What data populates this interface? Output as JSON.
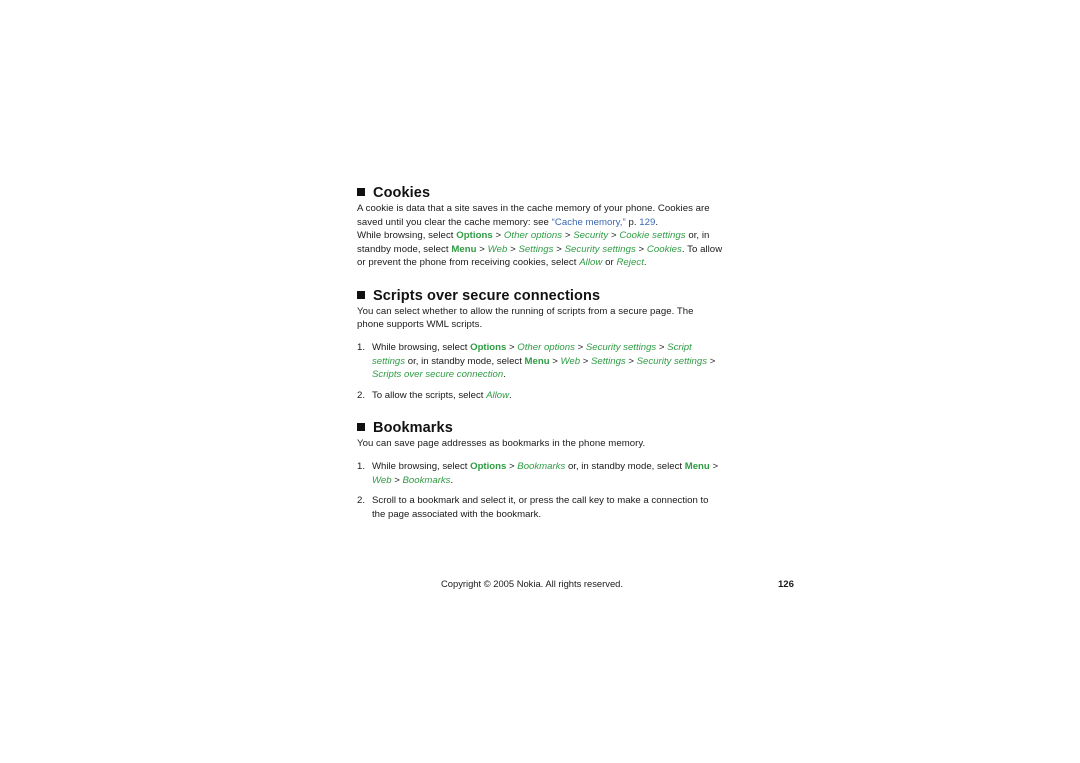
{
  "colors": {
    "ui_path_green": "#2e9c43",
    "cross_reference_blue": "#3a66b0",
    "body_text": "#1a1a1a",
    "heading_bullet": "#111111",
    "page_background": "#ffffff"
  },
  "sections": [
    {
      "id": "cookies",
      "heading": "Cookies",
      "bullet_icon": "filled-square-bullet",
      "paragraphs": [
        {
          "id": "cookies-intro",
          "runs": [
            {
              "text": "A cookie is data that a site saves in the cache memory of your phone. Cookies are saved until you clear the cache memory: see ",
              "style": "plain"
            },
            {
              "text": "“Cache memory,”",
              "style": "xref"
            },
            {
              "text": " p. ",
              "style": "plain"
            },
            {
              "text": "129",
              "style": "xref"
            },
            {
              "text": ".",
              "style": "plain"
            }
          ]
        },
        {
          "id": "cookies-path",
          "runs": [
            {
              "text": "While browsing, select ",
              "style": "plain"
            },
            {
              "text": "Options",
              "style": "ui-bold"
            },
            {
              "text": " > ",
              "style": "sep"
            },
            {
              "text": "Other options",
              "style": "ui-ital"
            },
            {
              "text": " > ",
              "style": "sep"
            },
            {
              "text": "Security",
              "style": "ui-ital"
            },
            {
              "text": " > ",
              "style": "sep"
            },
            {
              "text": "Cookie settings",
              "style": "ui-ital"
            },
            {
              "text": " or, in standby mode, select ",
              "style": "plain"
            },
            {
              "text": "Menu",
              "style": "ui-bold"
            },
            {
              "text": " > ",
              "style": "sep"
            },
            {
              "text": "Web",
              "style": "ui-ital"
            },
            {
              "text": " > ",
              "style": "sep"
            },
            {
              "text": "Settings",
              "style": "ui-ital"
            },
            {
              "text": " > ",
              "style": "sep"
            },
            {
              "text": "Security settings",
              "style": "ui-ital"
            },
            {
              "text": " > ",
              "style": "sep"
            },
            {
              "text": "Cookies",
              "style": "ui-ital"
            },
            {
              "text": ". To allow or prevent the phone from receiving cookies, select ",
              "style": "plain"
            },
            {
              "text": "Allow",
              "style": "ui-ital"
            },
            {
              "text": " or ",
              "style": "plain"
            },
            {
              "text": "Reject",
              "style": "ui-ital"
            },
            {
              "text": ".",
              "style": "plain"
            }
          ]
        }
      ],
      "steps": []
    },
    {
      "id": "scripts-over-secure-connections",
      "heading": "Scripts over secure connections",
      "bullet_icon": "filled-square-bullet",
      "paragraphs": [
        {
          "id": "scripts-intro",
          "runs": [
            {
              "text": "You can select whether to allow the running of scripts from a secure page. The phone supports WML scripts.",
              "style": "plain"
            }
          ]
        }
      ],
      "steps": [
        {
          "id": "scripts-step-1",
          "runs": [
            {
              "text": "While browsing, select ",
              "style": "plain"
            },
            {
              "text": "Options",
              "style": "ui-bold"
            },
            {
              "text": " > ",
              "style": "sep"
            },
            {
              "text": "Other options",
              "style": "ui-ital"
            },
            {
              "text": " > ",
              "style": "sep"
            },
            {
              "text": "Security settings",
              "style": "ui-ital"
            },
            {
              "text": " > ",
              "style": "sep"
            },
            {
              "text": "Script settings",
              "style": "ui-ital"
            },
            {
              "text": " or, in standby mode, select ",
              "style": "plain"
            },
            {
              "text": "Menu",
              "style": "ui-bold"
            },
            {
              "text": " > ",
              "style": "sep"
            },
            {
              "text": "Web",
              "style": "ui-ital"
            },
            {
              "text": " > ",
              "style": "sep"
            },
            {
              "text": "Settings",
              "style": "ui-ital"
            },
            {
              "text": " > ",
              "style": "sep"
            },
            {
              "text": "Security settings",
              "style": "ui-ital"
            },
            {
              "text": " > ",
              "style": "sep"
            },
            {
              "text": "Scripts over secure connection",
              "style": "ui-ital"
            },
            {
              "text": ".",
              "style": "plain"
            }
          ]
        },
        {
          "id": "scripts-step-2",
          "runs": [
            {
              "text": "To allow the scripts, select ",
              "style": "plain"
            },
            {
              "text": "Allow",
              "style": "ui-ital"
            },
            {
              "text": ".",
              "style": "plain"
            }
          ]
        }
      ]
    },
    {
      "id": "bookmarks",
      "heading": "Bookmarks",
      "bullet_icon": "filled-square-bullet",
      "paragraphs": [
        {
          "id": "bookmarks-intro",
          "runs": [
            {
              "text": "You can save page addresses as bookmarks in the phone memory.",
              "style": "plain"
            }
          ]
        }
      ],
      "steps": [
        {
          "id": "bookmarks-step-1",
          "runs": [
            {
              "text": "While browsing, select ",
              "style": "plain"
            },
            {
              "text": "Options",
              "style": "ui-bold"
            },
            {
              "text": " > ",
              "style": "sep"
            },
            {
              "text": "Bookmarks",
              "style": "ui-ital"
            },
            {
              "text": " or, in standby mode, select ",
              "style": "plain"
            },
            {
              "text": "Menu",
              "style": "ui-bold"
            },
            {
              "text": " > ",
              "style": "sep"
            },
            {
              "text": "Web",
              "style": "ui-ital"
            },
            {
              "text": " > ",
              "style": "sep"
            },
            {
              "text": "Bookmarks",
              "style": "ui-ital"
            },
            {
              "text": ".",
              "style": "plain"
            }
          ]
        },
        {
          "id": "bookmarks-step-2",
          "runs": [
            {
              "text": "Scroll to a bookmark and select it, or press the call key to make a connection to the page associated with the bookmark.",
              "style": "plain"
            }
          ]
        }
      ]
    }
  ],
  "footer": {
    "copyright": "Copyright © 2005 Nokia. All rights reserved.",
    "page_number": "126"
  }
}
